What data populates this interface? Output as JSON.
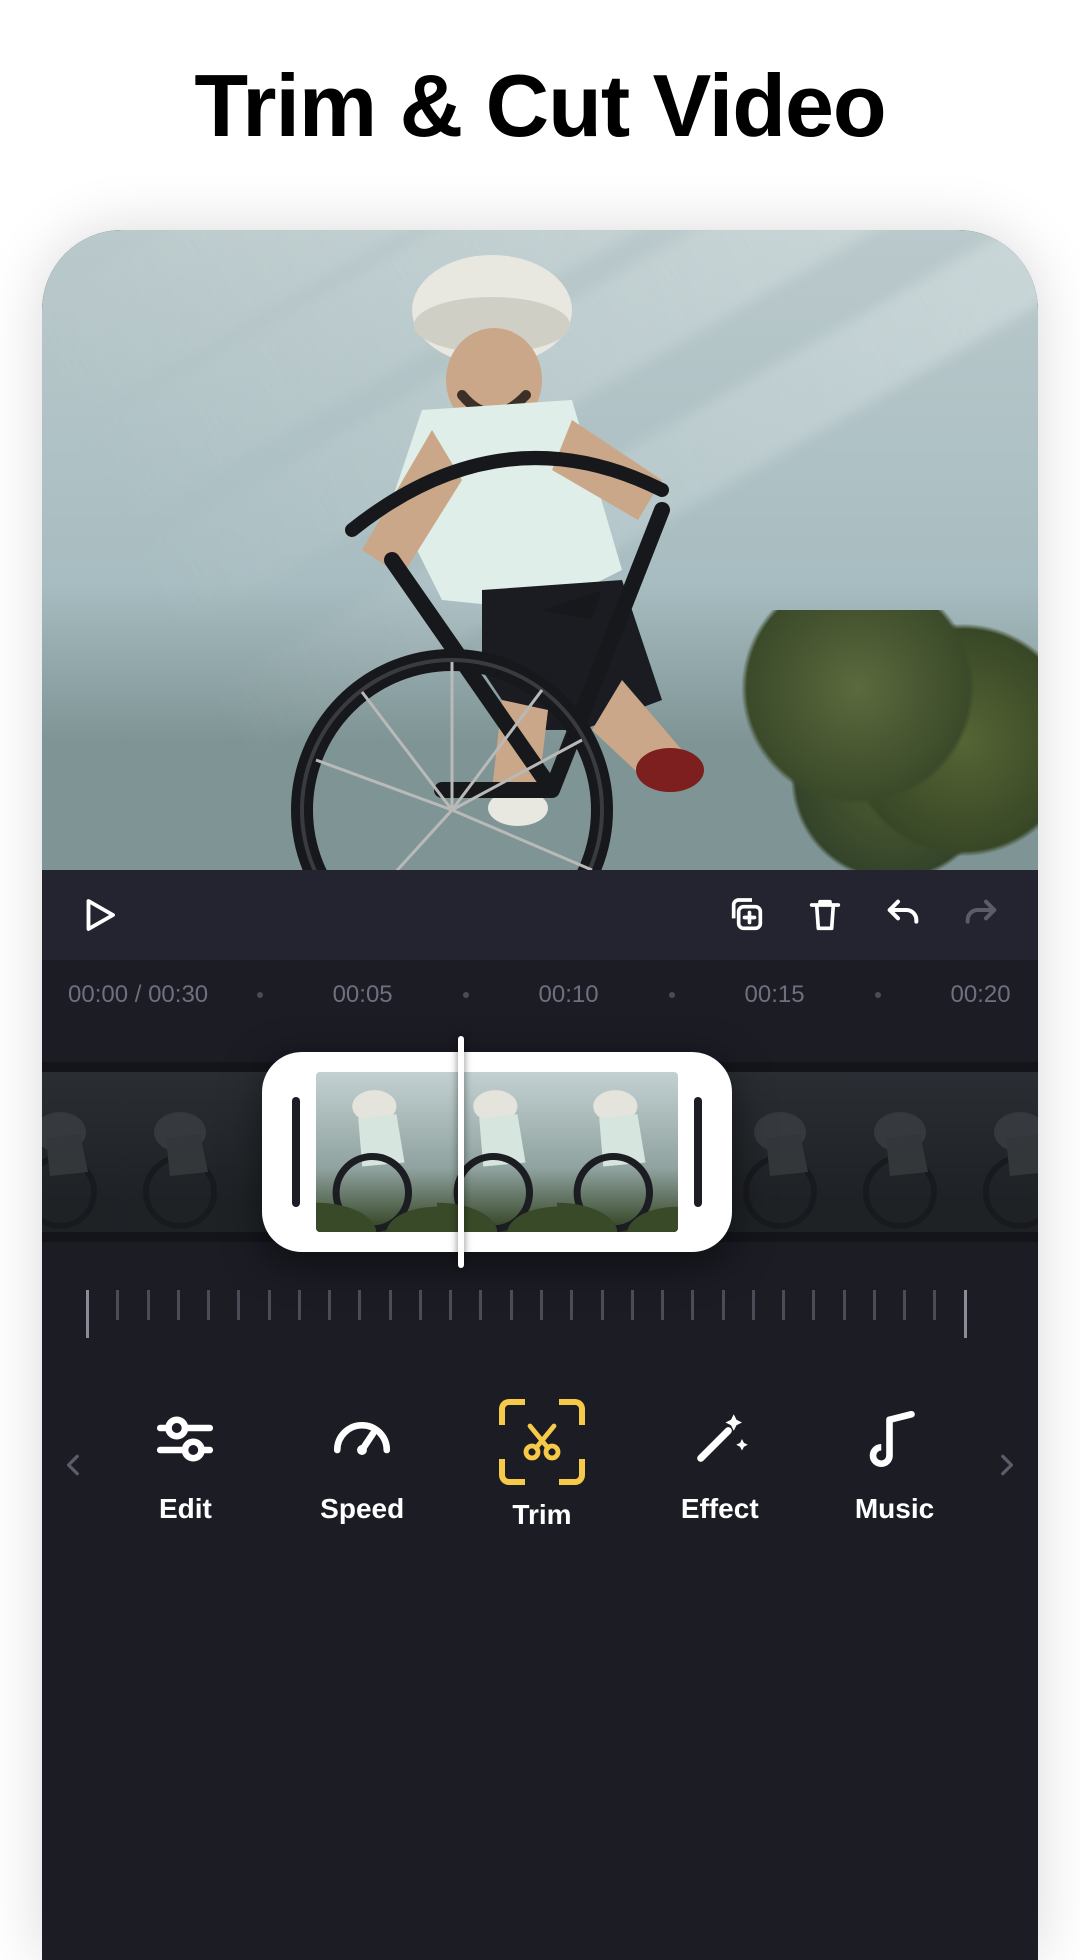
{
  "headline": "Trim & Cut Video",
  "playback": {
    "current": "00:00",
    "total": "00:30"
  },
  "ruler": {
    "marks": [
      "00:05",
      "00:10",
      "00:15",
      "00:20"
    ]
  },
  "toolbar": {
    "items": [
      {
        "label": "Edit"
      },
      {
        "label": "Speed"
      },
      {
        "label": "Trim"
      },
      {
        "label": "Effect"
      },
      {
        "label": "Music"
      }
    ],
    "active_index": 2
  },
  "colors": {
    "accent": "#f7c948",
    "panel": "#1b1c24"
  }
}
